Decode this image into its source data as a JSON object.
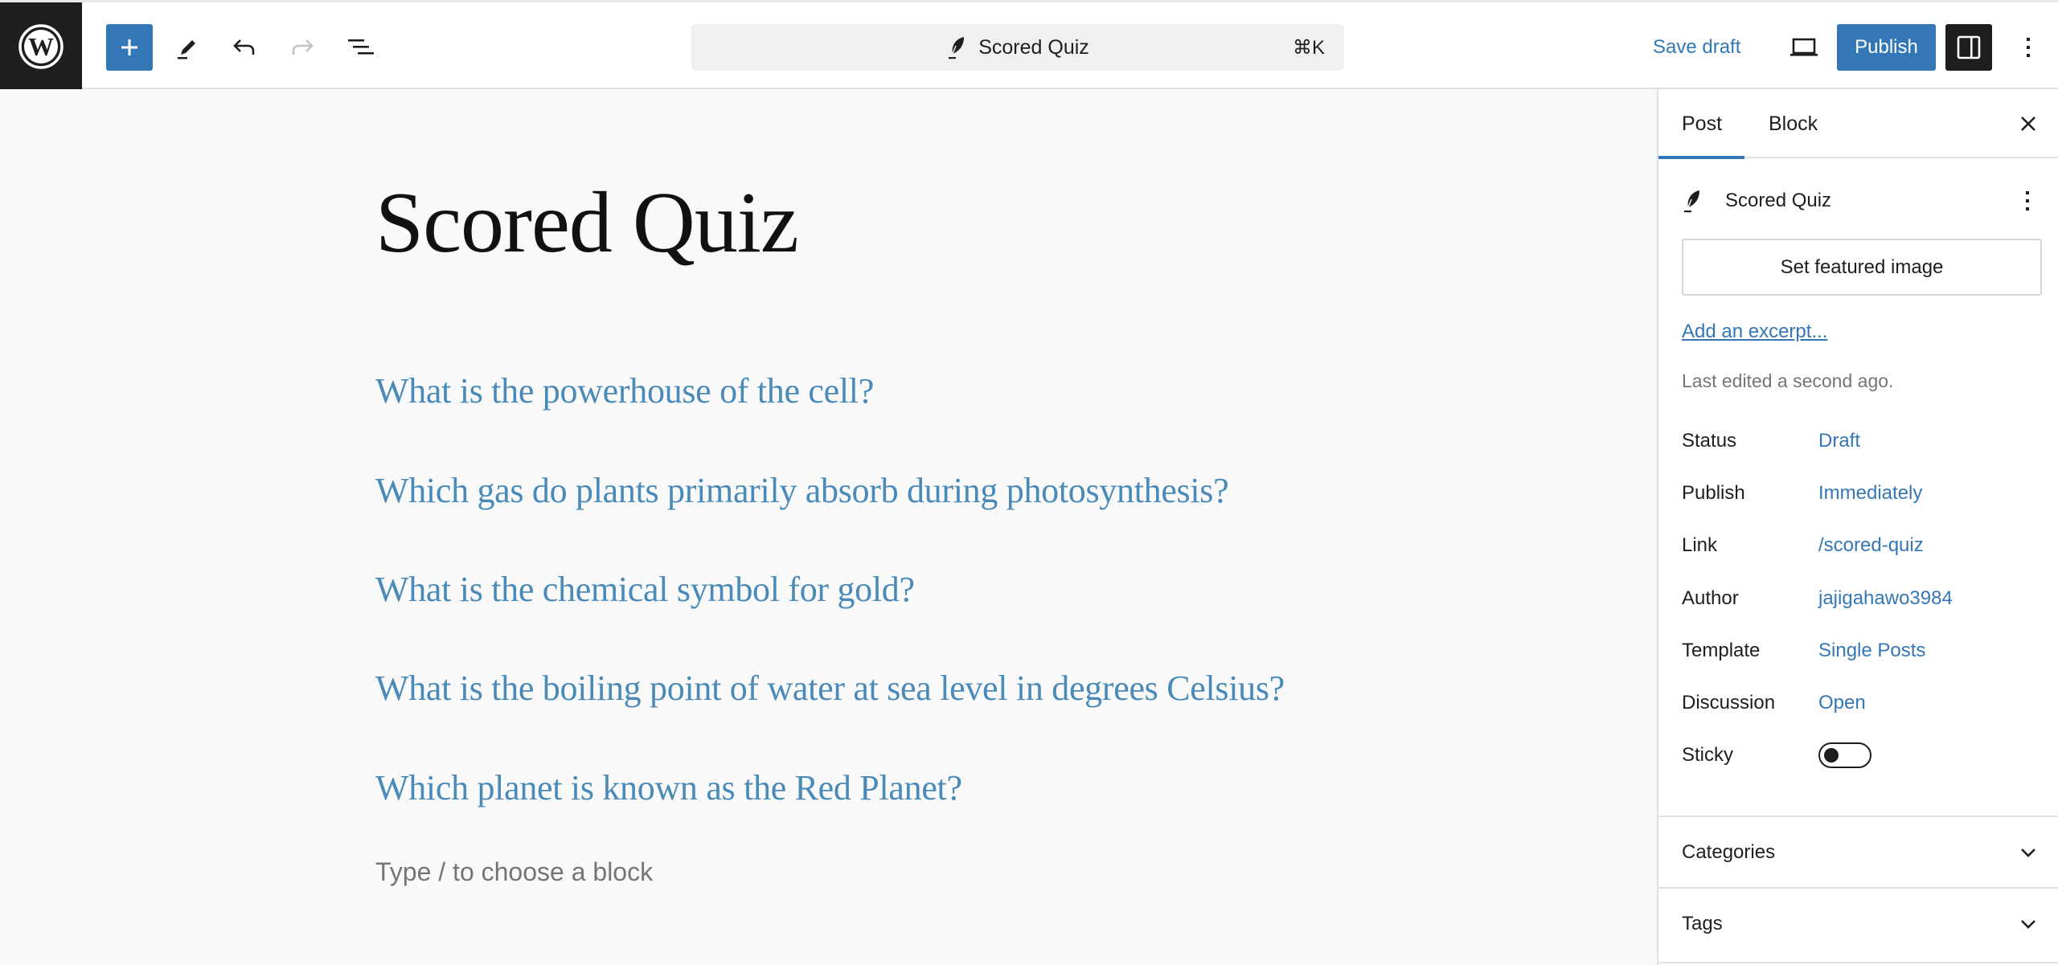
{
  "header": {
    "logo": "wordpress-logo",
    "tools": {
      "add_block": "plus-icon",
      "tools": "pencil-icon",
      "undo": "undo-icon",
      "redo": "redo-icon",
      "document_overview": "list-view-icon"
    },
    "command_bar": {
      "icon": "post-feather-icon",
      "title": "Scored Quiz",
      "shortcut": "⌘K"
    },
    "save_draft_label": "Save draft",
    "preview_icon": "laptop-icon",
    "publish_label": "Publish",
    "settings_icon": "sidebar-toggle-icon",
    "options_icon": "vertical-ellipsis-icon"
  },
  "editor": {
    "title": "Scored Quiz",
    "questions": [
      "What is the powerhouse of the cell?",
      "Which gas do plants primarily absorb during photosynthesis?",
      "What is the chemical symbol for gold?",
      "What is the boiling point of water at sea level in degrees Celsius?",
      "Which planet is known as the Red Planet?"
    ],
    "placeholder": "Type / to choose a block"
  },
  "sidebar": {
    "tabs": [
      {
        "label": "Post",
        "active": true
      },
      {
        "label": "Block",
        "active": false
      }
    ],
    "post_card": {
      "icon": "post-feather-icon",
      "title": "Scored Quiz"
    },
    "featured_image_label": "Set featured image",
    "excerpt_link": "Add an excerpt...",
    "last_edited": "Last edited a second ago.",
    "meta": [
      {
        "label": "Status",
        "value": "Draft"
      },
      {
        "label": "Publish",
        "value": "Immediately"
      },
      {
        "label": "Link",
        "value": "/scored-quiz"
      },
      {
        "label": "Author",
        "value": "jajigahawo3984"
      },
      {
        "label": "Template",
        "value": "Single Posts"
      },
      {
        "label": "Discussion",
        "value": "Open"
      }
    ],
    "sticky": {
      "label": "Sticky",
      "checked": false
    },
    "panels": [
      {
        "title": "Categories",
        "expanded": false
      },
      {
        "title": "Tags",
        "expanded": false
      }
    ]
  },
  "colors": {
    "accent": "#3477b6",
    "question_text": "#4a8ab8",
    "dark": "#1e1e1e",
    "muted": "#757575"
  }
}
